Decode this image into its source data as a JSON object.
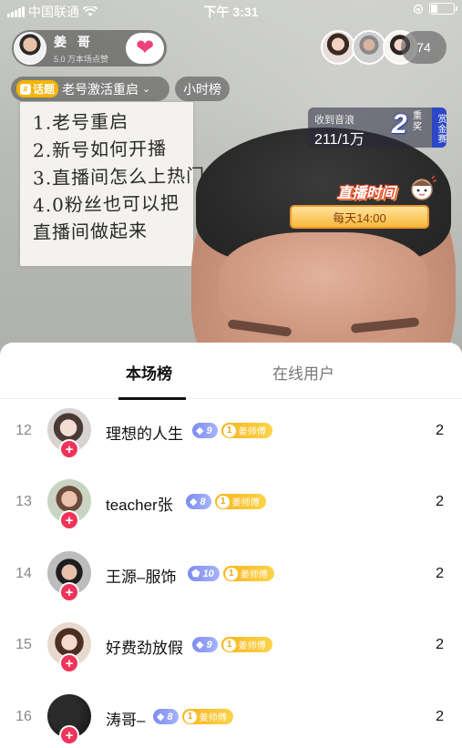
{
  "status_bar": {
    "carrier": "中国联通",
    "time": "下午 3:31"
  },
  "host": {
    "name": "姜 哥",
    "subtitle": "5.0 万本场点赞",
    "follow_icon": "heart-icon"
  },
  "viewer_count": "74",
  "topic": {
    "tag_label": "话题",
    "title": "老号激活重启"
  },
  "hour_rank_label": "小时榜",
  "reward": {
    "label": "收到音浪",
    "value": "211/1万",
    "big_number": "2",
    "big_suffix": "重奖",
    "side_label": "赏金赛"
  },
  "live_badge": {
    "title": "直播时间",
    "schedule": "每天14:00"
  },
  "video_note_lines": [
    "1.老号重启",
    "2.新号如何开播",
    "3.直播间怎么上热门",
    "4.0粉丝也可以把",
    "直播间做起来"
  ],
  "sheet": {
    "tabs": [
      "本场榜",
      "在线用户"
    ],
    "active_tab": 0
  },
  "ranking": [
    {
      "rank": "12",
      "name": "理想的人生",
      "level": "9",
      "fan_badge_level": "1",
      "fan_badge": "姜师傅",
      "score": "2"
    },
    {
      "rank": "13",
      "name": "teacher张",
      "level": "8",
      "fan_badge_level": "1",
      "fan_badge": "姜师傅",
      "score": "2"
    },
    {
      "rank": "14",
      "name": "王源–服饰",
      "level": "10",
      "fan_badge_level": "1",
      "fan_badge": "姜师傅",
      "score": "2"
    },
    {
      "rank": "15",
      "name": "好费劲放假",
      "level": "9",
      "fan_badge_level": "1",
      "fan_badge": "姜师傅",
      "score": "2"
    },
    {
      "rank": "16",
      "name": "涛哥–",
      "level": "8",
      "fan_badge_level": "1",
      "fan_badge": "姜师傅",
      "score": "2"
    }
  ],
  "colors": {
    "accent_pink": "#f0335a",
    "level_badge": "#7c8cf0",
    "fan_badge": "#f8b51b",
    "topic_tag": "#f5b400"
  }
}
